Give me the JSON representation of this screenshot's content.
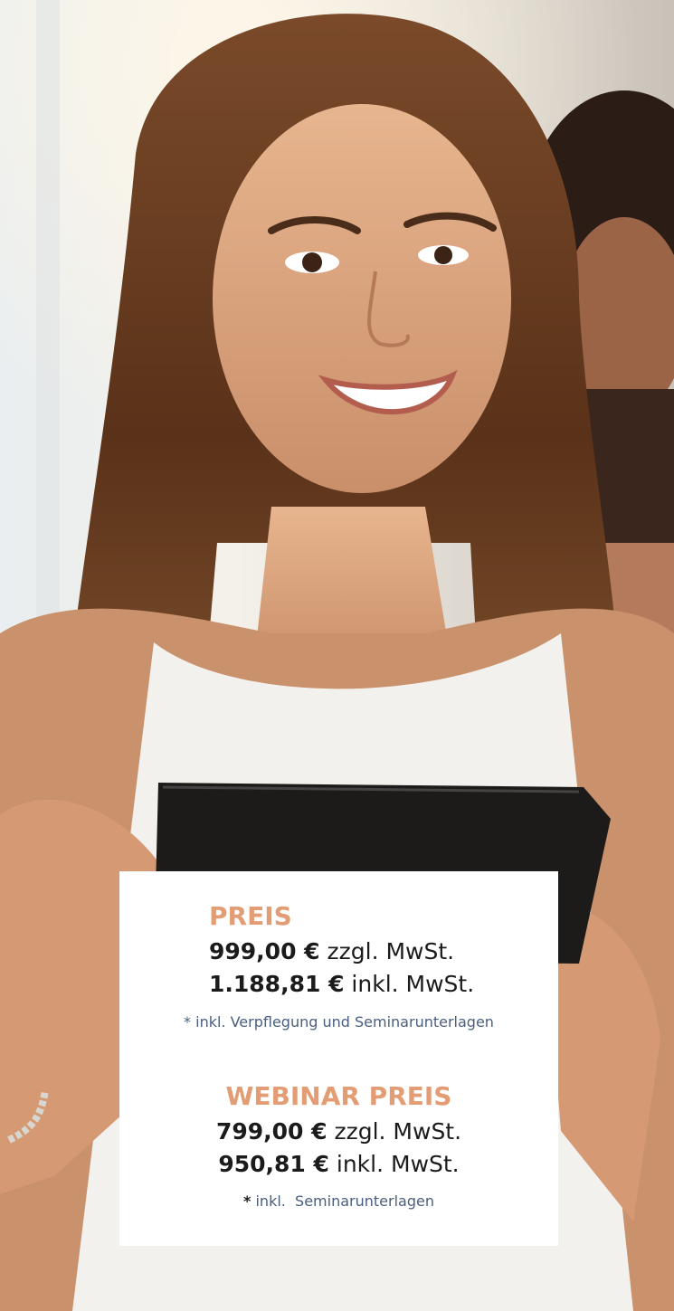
{
  "colors": {
    "accent": "#e39d74",
    "note": "#4a5f80",
    "text": "#1b1b1b",
    "card": "#ffffff"
  },
  "photo": {
    "subject": "smiling woman with long brown hair holding a black tablet, second woman in background"
  },
  "price": {
    "title": "PREIS",
    "net_amount": "999,00 €",
    "net_label": "zzgl. MwSt.",
    "gross_amount": "1.188,81 €",
    "gross_label": "inkl. MwSt.",
    "note": "* inkl. Verpflegung und Seminarunterlagen"
  },
  "webinar": {
    "title": "WEBINAR PREIS",
    "net_amount": "799,00 €",
    "net_label": "zzgl. MwSt.",
    "gross_amount": "950,81 €",
    "gross_label": "inkl. MwSt.",
    "note_star": "*",
    "note": "inkl.  Seminarunterlagen"
  }
}
